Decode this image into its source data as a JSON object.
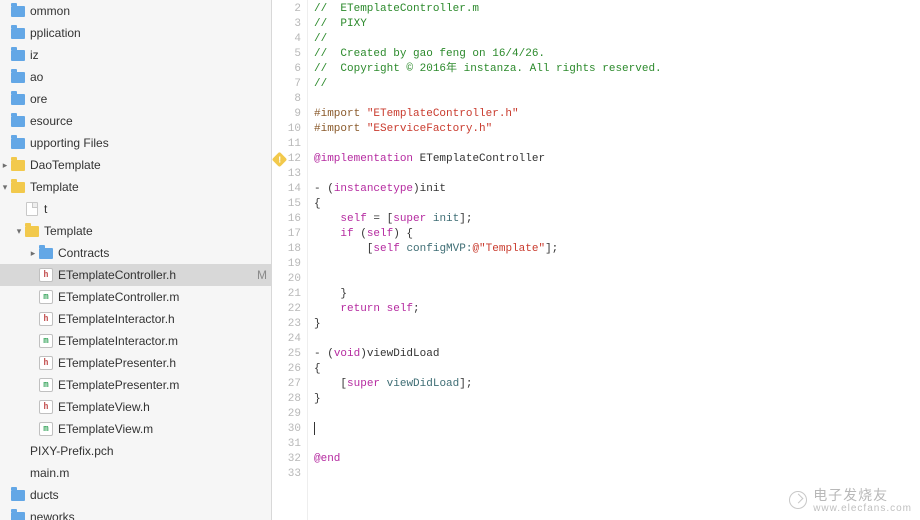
{
  "sidebar": {
    "items": [
      {
        "label": "ommon",
        "icon": "folder",
        "indent": "cut"
      },
      {
        "label": "pplication",
        "icon": "folder",
        "indent": "cut"
      },
      {
        "label": "iz",
        "icon": "folder",
        "indent": "cut"
      },
      {
        "label": "ao",
        "icon": "folder",
        "indent": "cut"
      },
      {
        "label": "ore",
        "icon": "folder",
        "indent": "cut"
      },
      {
        "label": "esource",
        "icon": "folder",
        "indent": "cut"
      },
      {
        "label": "upporting Files",
        "icon": "folder",
        "indent": "cut"
      },
      {
        "label": "DaoTemplate",
        "icon": "folder-yellow",
        "indent": "ind0",
        "disclosure": "▸"
      },
      {
        "label": "Template",
        "icon": "folder-yellow",
        "indent": "ind0",
        "disclosure": "▾"
      },
      {
        "label": "t",
        "icon": "file-plain",
        "indent": "ind1"
      },
      {
        "label": "Template",
        "icon": "folder-yellow",
        "indent": "ind1",
        "disclosure": "▾"
      },
      {
        "label": "Contracts",
        "icon": "folder",
        "indent": "ind2",
        "disclosure": "▸"
      },
      {
        "label": "ETemplateController.h",
        "icon": "file-h",
        "indent": "ind2",
        "selected": true,
        "status": "M"
      },
      {
        "label": "ETemplateController.m",
        "icon": "file-m",
        "indent": "ind2"
      },
      {
        "label": "ETemplateInteractor.h",
        "icon": "file-h",
        "indent": "ind2"
      },
      {
        "label": "ETemplateInteractor.m",
        "icon": "file-m",
        "indent": "ind2"
      },
      {
        "label": "ETemplatePresenter.h",
        "icon": "file-h",
        "indent": "ind2"
      },
      {
        "label": "ETemplatePresenter.m",
        "icon": "file-m",
        "indent": "ind2"
      },
      {
        "label": "ETemplateView.h",
        "icon": "file-h",
        "indent": "ind2"
      },
      {
        "label": "ETemplateView.m",
        "icon": "file-m",
        "indent": "ind2"
      },
      {
        "label": "PIXY-Prefix.pch",
        "icon": "none",
        "indent": "ind0"
      },
      {
        "label": "main.m",
        "icon": "none",
        "indent": "ind0"
      },
      {
        "label": "ducts",
        "icon": "folder",
        "indent": "cut"
      },
      {
        "label": "neworks",
        "icon": "folder",
        "indent": "cut"
      }
    ]
  },
  "editor": {
    "first_line_no": 2,
    "warning_line": 12,
    "cursor_line": 30,
    "lines": [
      {
        "n": 2,
        "t": "//  ETemplateController.m",
        "cls": "tk-comment"
      },
      {
        "n": 3,
        "t": "//  PIXY",
        "cls": "tk-comment"
      },
      {
        "n": 4,
        "t": "//",
        "cls": "tk-comment"
      },
      {
        "n": 5,
        "t": "//  Created by gao feng on 16/4/26.",
        "cls": "tk-comment"
      },
      {
        "n": 6,
        "t": "//  Copyright © 2016年 instanza. All rights reserved.",
        "cls": "tk-comment"
      },
      {
        "n": 7,
        "t": "//",
        "cls": "tk-comment"
      },
      {
        "n": 8,
        "t": ""
      },
      {
        "n": 9,
        "seg": [
          {
            "t": "#import ",
            "cls": "tk-pre"
          },
          {
            "t": "\"ETemplateController.h\"",
            "cls": "tk-string"
          }
        ]
      },
      {
        "n": 10,
        "seg": [
          {
            "t": "#import ",
            "cls": "tk-pre"
          },
          {
            "t": "\"EServiceFactory.h\"",
            "cls": "tk-string"
          }
        ]
      },
      {
        "n": 11,
        "t": ""
      },
      {
        "n": 12,
        "seg": [
          {
            "t": "@implementation",
            "cls": "tk-keyword"
          },
          {
            "t": " ETemplateController"
          }
        ],
        "u": [
          19,
          38
        ]
      },
      {
        "n": 13,
        "t": ""
      },
      {
        "n": 14,
        "seg": [
          {
            "t": "- ("
          },
          {
            "t": "instancetype",
            "cls": "tk-keyword"
          },
          {
            "t": ")init"
          }
        ]
      },
      {
        "n": 15,
        "t": "{"
      },
      {
        "n": 16,
        "seg": [
          {
            "t": "    "
          },
          {
            "t": "self",
            "cls": "tk-keyword"
          },
          {
            "t": " = ["
          },
          {
            "t": "super",
            "cls": "tk-keyword"
          },
          {
            "t": " "
          },
          {
            "t": "init",
            "cls": "tk-msg"
          },
          {
            "t": "];"
          }
        ]
      },
      {
        "n": 17,
        "seg": [
          {
            "t": "    "
          },
          {
            "t": "if",
            "cls": "tk-keyword"
          },
          {
            "t": " ("
          },
          {
            "t": "self",
            "cls": "tk-keyword"
          },
          {
            "t": ") {"
          }
        ]
      },
      {
        "n": 18,
        "seg": [
          {
            "t": "        ["
          },
          {
            "t": "self",
            "cls": "tk-keyword"
          },
          {
            "t": " "
          },
          {
            "t": "configMVP:",
            "cls": "tk-msg"
          },
          {
            "t": "@\"Template\"",
            "cls": "tk-string"
          },
          {
            "t": "];"
          }
        ]
      },
      {
        "n": 19,
        "t": ""
      },
      {
        "n": 20,
        "t": ""
      },
      {
        "n": 21,
        "t": "    }"
      },
      {
        "n": 22,
        "seg": [
          {
            "t": "    "
          },
          {
            "t": "return",
            "cls": "tk-keyword"
          },
          {
            "t": " "
          },
          {
            "t": "self",
            "cls": "tk-keyword"
          },
          {
            "t": ";"
          }
        ]
      },
      {
        "n": 23,
        "t": "}"
      },
      {
        "n": 24,
        "t": ""
      },
      {
        "n": 25,
        "seg": [
          {
            "t": "- ("
          },
          {
            "t": "void",
            "cls": "tk-keyword"
          },
          {
            "t": ")viewDidLoad"
          }
        ]
      },
      {
        "n": 26,
        "t": "{"
      },
      {
        "n": 27,
        "seg": [
          {
            "t": "    ["
          },
          {
            "t": "super",
            "cls": "tk-keyword"
          },
          {
            "t": " "
          },
          {
            "t": "viewDidLoad",
            "cls": "tk-msg"
          },
          {
            "t": "];"
          }
        ]
      },
      {
        "n": 28,
        "t": "}"
      },
      {
        "n": 29,
        "t": ""
      },
      {
        "n": 30,
        "t": "",
        "cursor": true
      },
      {
        "n": 31,
        "t": ""
      },
      {
        "n": 32,
        "seg": [
          {
            "t": "@end",
            "cls": "tk-keyword"
          }
        ]
      },
      {
        "n": 33,
        "t": ""
      }
    ]
  },
  "watermark": {
    "text": "电子发烧友",
    "url": "www.elecfans.com"
  }
}
